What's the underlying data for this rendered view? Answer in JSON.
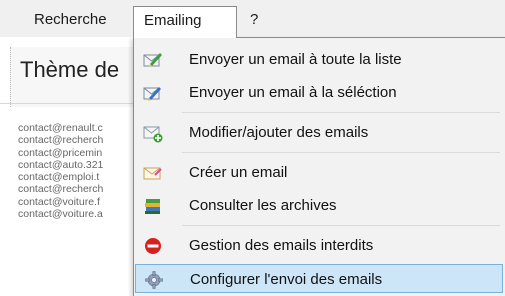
{
  "menubar": {
    "items": [
      "Recherche",
      "Emailing",
      "?"
    ]
  },
  "content": {
    "theme_title": "Thème de",
    "emails": [
      "contact@renault.c",
      "contact@recherch",
      "contact@pricemin",
      "contact@auto.321",
      "contact@emploi.t",
      "contact@recherch",
      "contact@voiture.f",
      "contact@voiture.a"
    ]
  },
  "dropdown": {
    "items": [
      {
        "label": "Envoyer un email à toute la liste",
        "icon": "send-all-icon"
      },
      {
        "label": "Envoyer un email à la séléction",
        "icon": "send-selection-icon"
      },
      {
        "label": "Modifier/ajouter des emails",
        "icon": "edit-emails-icon"
      },
      {
        "label": "Créer un email",
        "icon": "create-email-icon"
      },
      {
        "label": "Consulter les archives",
        "icon": "archives-icon"
      },
      {
        "label": "Gestion des emails interdits",
        "icon": "forbidden-icon"
      },
      {
        "label": "Configurer l'envoi des emails",
        "icon": "gear-icon"
      }
    ],
    "selected_index": 6,
    "colors": {
      "highlight": "#cde6f7",
      "highlight_border": "#7ab1dc"
    }
  }
}
